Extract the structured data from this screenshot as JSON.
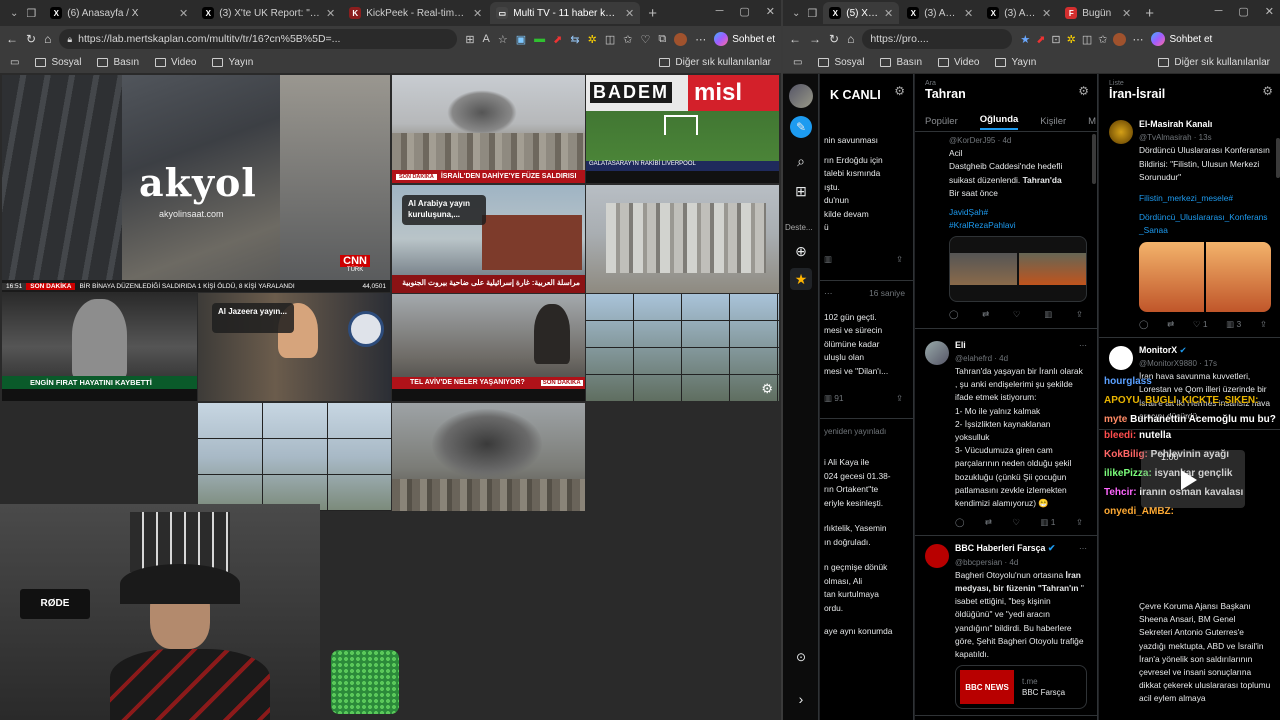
{
  "left_window": {
    "tabs": [
      {
        "title": "(6) Anasayfa / X",
        "favicon": "x-logo-icon",
        "active": false
      },
      {
        "title": "(3) X'te UK Report: \"ısus... — A",
        "favicon": "x-logo-icon",
        "active": false
      },
      {
        "title": "KickPeek - Real-time URL Craw",
        "favicon": "kickpeek-icon",
        "active": false
      },
      {
        "title": "Multi TV - 11 haber kanalı ay",
        "favicon": "tv-icon",
        "active": true
      }
    ],
    "address": "https://lab.mertskaplan.com/multitv/tr/16?cn%5B%5D=...",
    "chat_label": "Sohbet et",
    "bookmarks": [
      "Sosyal",
      "Basın",
      "Video",
      "Yayın"
    ],
    "other_favorites": "Diğer sık kullanılanlar"
  },
  "multitv": {
    "akyol_title": "akyol",
    "akyol_url": "akyolinsaat.com",
    "cnn_brand": "CNN",
    "cnn_sub": "TÜRK",
    "cnn_ticker_time": "16:51",
    "cnn_ticker_tag": "SON DAKİKA",
    "cnn_ticker_text": "BİR BİNAYA DÜZENLEDİĞİ SALDIRIDA 1 KİŞİ ÖLDÜ, 8 KİŞİ YARALANDI",
    "cnn_ticker_value": "44,0501",
    "israil_tag": "SON DAKİKA",
    "israil_text": "İSRAİL'DEN DAHİYE'YE FÜZE SALDIRISI",
    "badem_brand": "BADEM",
    "badem_brand2": "misl",
    "galatasaray_text": "GALATASARAY'IN RAKİBİ LIVERPOOL",
    "aljazeera_card": "Al Arabiya yayın kuruluşuna,...",
    "arabic_ticker": "مراسلة العربية: غارة إسرائيلية على ضاحية بيروت الجنوبية",
    "fighter_text": "ENGİN FIRAT HAYATINI KAYBETTİ",
    "aljazeera2_card": "Al Jazeera yayın...",
    "telaviv_text": "TEL AVİV'DE NELER YAŞANIYOR?",
    "telaviv_tag": "SON DAKİKA",
    "time_overlay": "1.00"
  },
  "right_window": {
    "tabs": [
      {
        "title": "(5) X Pro",
        "favicon": "x-logo-icon",
        "active": true
      },
      {
        "title": "(3) Anasay",
        "favicon": "x-logo-icon",
        "active": false
      },
      {
        "title": "(3) Anasay",
        "favicon": "x-logo-icon",
        "active": false
      },
      {
        "title": "Bugün",
        "favicon": "f-logo-icon",
        "active": false
      }
    ],
    "address": "https://pro....",
    "chat_label": "Sohbet et",
    "bookmarks": [
      "Sosyal",
      "Basın",
      "Video",
      "Yayın"
    ],
    "other_favorites": "Diğer sık kullanılanlar"
  },
  "xpro": {
    "deste_label": "Deste...",
    "col1": {
      "title": "K CANLI",
      "lines": [
        "nin savunması",
        "rın Erdoğdu için",
        "talebi kısmında",
        "ıştu.",
        "du'nun",
        "kilde devam",
        "ü"
      ],
      "lines2_time": "16 saniye",
      "lines2": [
        "102 gün geçti.",
        "mesi ve sürecin",
        "ölümüne kadar",
        "uluşlu olan",
        "mesi ve \"Dilan'ı..."
      ],
      "count": "91",
      "retweeted": "yeniden yayınladı",
      "lines3": [
        "i Ali Kaya ile",
        "024 gecesi 01.38-",
        "rın Ortakent\"te",
        "eriyle kesinleşti."
      ],
      "lines4": [
        "rlıktelik, Yasemin",
        "ın doğruladı."
      ],
      "lines5": [
        "n geçmişe dönük",
        "olması, Ali",
        "tan kurtulmaya",
        "ordu."
      ],
      "lines6": "aye aynı konumda"
    },
    "col2": {
      "sub": "Ara",
      "title": "Tahran",
      "tabs": [
        "Popüler",
        "Oğlunda",
        "Kişiler",
        "M"
      ],
      "active_tab": "Oğlunda",
      "tweet1": {
        "handle": "@KorDerJ95 · 4d",
        "line1": "Acil",
        "line2a": "Dastgheib Caddesi'nde hedefli suikast düzenlendi. ",
        "line2b": "Tahran'da",
        "line3": "Bir saat önce",
        "tag1": "JavidŞah#",
        "tag2": "#KralRezaPahlavi"
      },
      "tweet2": {
        "name": "Eli",
        "handle": "@elahefrd · 4d",
        "body": [
          "Tahran'da yaşayan bir İranlı olarak , şu anki endişelerimi şu şekilde ifade etmek istiyorum:",
          "1- Mo ile yalnız kalmak",
          "2- İşsizlikten kaynaklanan yoksulluk",
          "3- Vücudumuza giren cam parçalarının neden olduğu şekil bozukluğu (çünkü Şii çocuğun patlamasını zevkle izlemekten kendimizi alamıyoruz) 😁"
        ],
        "retweets": "1"
      },
      "tweet3": {
        "name": "BBC Haberleri Farsça",
        "handle": "@bbcpersian · 4d",
        "body1": "Bagheri Otoyolu'nun ortasına ",
        "body2": "İran medyası, bir füzenin \"",
        "body3": "Tahran'ın",
        "body4": " \" isabet ettiğini, \"beş kişinin öldüğünü\" ve \"yedi aracın yandığını\" bildirdi. Bu haberlere göre, Şehit Bagheri Otoyolu trafiğe kapatıldı.",
        "card_logo": "BBC NEWS",
        "card_t": "t.me",
        "card_title": "BBC Farsça"
      }
    },
    "col3": {
      "sub": "Liste",
      "title": "İran-İsrail",
      "tweet1": {
        "name": "El-Masirah Kanalı",
        "handle": "@TvAlmasirah · 13s",
        "body": "Dördüncü Uluslararası Konferansın Bildirisi: \"Filistin, Ulusun Merkezi Sorunudur\"",
        "tag1": "Filistin_merkezi_mesele#",
        "tag2": "Dördüncü_Uluslararası_Konferans_Sanaa",
        "likes": "1",
        "views": "3"
      },
      "tweet2": {
        "name": "MonitorX",
        "handle": "@MonitorX9880 · 17s",
        "body": "İran hava savunma kuvvetleri, Lorestan ve Qom illeri üzerinde bir İsrail'e ait İki Hermes insansız hava aracını düşürdü."
      },
      "tweet3_body": "Çevre Koruma Ajansı Başkanı Sheena Ansari, BM Genel Sekreteri Antonio Guterres'e yazdığı mektupta, ABD ve İsrail'in İran'a yönelik son saldırılarının çevresel ve insani sonuçlarına dikkat çekerek uluslararası toplumu acil eylem almaya"
    }
  },
  "stream_chat": [
    {
      "user": "hourglass",
      "msg": "",
      "color": "#5aa0ff"
    },
    {
      "user": "APOYU_BUGLI_KICKTE_SIKEN:",
      "msg": "",
      "color": "#e8b400"
    },
    {
      "user": "myte",
      "msg": "Burhanettin Acemoğlu mu bu?",
      "color": "#ff8a65"
    },
    {
      "user": "bleedi:",
      "msg": "nutella",
      "color": "#ff4d4d"
    },
    {
      "user": "KokBilig:",
      "msg": "Pehlevinin ayağı",
      "color": "#ff6666"
    },
    {
      "user": "ilikePizza:",
      "msg": "isyankar gençlik",
      "color": "#7cff7c"
    },
    {
      "user": "Tehcir:",
      "msg": "iranın osman kavalası",
      "color": "#ff66ff"
    },
    {
      "user": "onyedi_AMBZ:",
      "msg": "",
      "color": "#ffaa33"
    }
  ],
  "video_overlay_time": "1.00",
  "webcam": {
    "mic_brand": "RØDE"
  },
  "colors": {
    "accent": "#1d9bf0",
    "cnn_red": "#cc0000",
    "bg": "#202124"
  }
}
